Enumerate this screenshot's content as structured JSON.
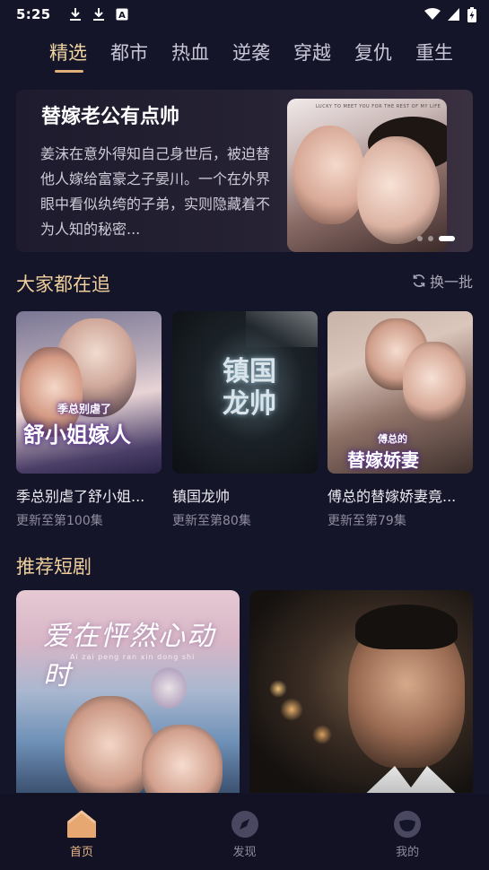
{
  "status_bar": {
    "time": "5:25",
    "left_icons": [
      "download-icon",
      "download-icon",
      "keyboard-a-icon"
    ],
    "right_icons": [
      "wifi-icon",
      "signal-icon",
      "battery-charging-icon"
    ]
  },
  "top_tabs": [
    {
      "label": "精选",
      "active": true
    },
    {
      "label": "都市",
      "active": false
    },
    {
      "label": "热血",
      "active": false
    },
    {
      "label": "逆袭",
      "active": false
    },
    {
      "label": "穿越",
      "active": false
    },
    {
      "label": "复仇",
      "active": false
    },
    {
      "label": "重生",
      "active": false
    }
  ],
  "banner": {
    "title": "替嫁老公有点帅",
    "description": "姜沫在意外得知自己身世后，被迫替他人嫁给富豪之子晏川。一个在外界眼中看似纨绔的子弟，实则隐藏着不为人知的秘密...",
    "art_caption": "LUCKY TO MEET YOU FOR THE REST OF MY LIFE",
    "slide_count": 3,
    "active_slide": 3
  },
  "trending": {
    "title": "大家都在追",
    "refresh_label": "换一批",
    "items": [
      {
        "title": "季总别虐了舒小姐...",
        "subtitle": "更新至第100集",
        "cover_small": "季总别虐了",
        "cover_big": "舒小姐嫁人"
      },
      {
        "title": "镇国龙帅",
        "subtitle": "更新至第80集",
        "cover_big": "镇国龙帅"
      },
      {
        "title": "傅总的替嫁娇妻竟...",
        "subtitle": "更新至第79集",
        "cover_small": "傅总的",
        "cover_big": "替嫁娇妻"
      }
    ]
  },
  "recommended": {
    "title": "推荐短剧",
    "items": [
      {
        "cover_title": "爱在怦然心动时",
        "cover_subtitle": "Ai zai peng ran xin dong shi"
      },
      {
        "cover_title": ""
      }
    ]
  },
  "bottom_nav": [
    {
      "label": "首页",
      "icon": "home-icon",
      "active": true
    },
    {
      "label": "发现",
      "icon": "compass-icon",
      "active": false
    },
    {
      "label": "我的",
      "icon": "profile-icon",
      "active": false
    }
  ],
  "colors": {
    "background": "#15152a",
    "accent": "#f0cf9c",
    "active_tab": "#f1d5a2",
    "muted_text": "#8f8c9d",
    "nav_active": "#e7b68a"
  }
}
